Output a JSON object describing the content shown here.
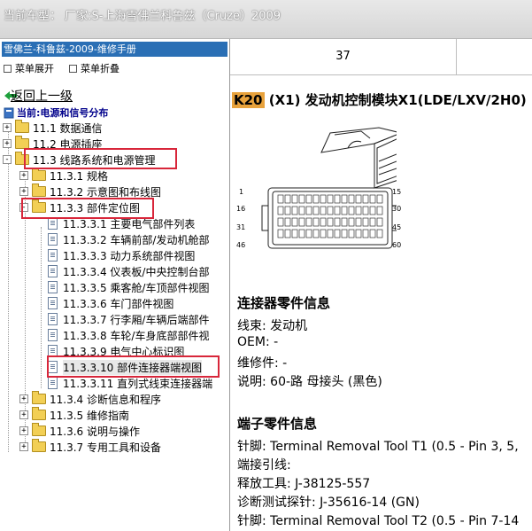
{
  "title": "当前车型：  厂家:S-上海雪佛兰科鲁兹（Cruze）2009",
  "left_panel": {
    "header": "雪佛兰-科鲁兹-2009-维修手册",
    "expand_all": "菜单展开",
    "collapse_all": "菜单折叠",
    "back_link": "返回上一级",
    "current": "当前:电源和信号分布",
    "tree": [
      {
        "label": "11.1 数据通信",
        "level": 0,
        "type": "folder",
        "toggle": "+"
      },
      {
        "label": "11.2 电源插座",
        "level": 0,
        "type": "folder",
        "toggle": "+"
      },
      {
        "label": "11.3 线路系统和电源管理",
        "level": 0,
        "type": "folder",
        "toggle": "-"
      },
      {
        "label": "11.3.1 规格",
        "level": 1,
        "type": "folder",
        "toggle": "+"
      },
      {
        "label": "11.3.2 示意图和布线图",
        "level": 1,
        "type": "folder",
        "toggle": "+"
      },
      {
        "label": "11.3.3 部件定位图",
        "level": 1,
        "type": "folder",
        "toggle": "-"
      },
      {
        "label": "11.3.3.1 主要电气部件列表",
        "level": 2,
        "type": "doc"
      },
      {
        "label": "11.3.3.2 车辆前部/发动机舱部",
        "level": 2,
        "type": "doc"
      },
      {
        "label": "11.3.3.3 动力系统部件视图",
        "level": 2,
        "type": "doc"
      },
      {
        "label": "11.3.3.4 仪表板/中央控制台部",
        "level": 2,
        "type": "doc"
      },
      {
        "label": "11.3.3.5 乘客舱/车顶部件视图",
        "level": 2,
        "type": "doc"
      },
      {
        "label": "11.3.3.6 车门部件视图",
        "level": 2,
        "type": "doc"
      },
      {
        "label": "11.3.3.7 行李厢/车辆后端部件",
        "level": 2,
        "type": "doc"
      },
      {
        "label": "11.3.3.8 车轮/车身底部部件视",
        "level": 2,
        "type": "doc"
      },
      {
        "label": "11.3.3.9 电气中心标识图",
        "level": 2,
        "type": "doc"
      },
      {
        "label": "11.3.3.10 部件连接器端视图",
        "level": 2,
        "type": "doc",
        "selected": true
      },
      {
        "label": "11.3.3.11 直列式线束连接器端",
        "level": 2,
        "type": "doc"
      },
      {
        "label": "11.3.4 诊断信息和程序",
        "level": 1,
        "type": "folder",
        "toggle": "+"
      },
      {
        "label": "11.3.5 维修指南",
        "level": 1,
        "type": "folder",
        "toggle": "+"
      },
      {
        "label": "11.3.6 说明与操作",
        "level": 1,
        "type": "folder",
        "toggle": "+"
      },
      {
        "label": "11.3.7 专用工具和设备",
        "level": 1,
        "type": "folder",
        "toggle": "+"
      }
    ]
  },
  "right_panel": {
    "table_cell": "37",
    "heading_code": "K20",
    "heading_text": "(X1) 发动机控制模块X1(LDE/LXV/2H0)",
    "pin_labels": [
      "1",
      "15",
      "16",
      "30",
      "31",
      "45",
      "46",
      "60"
    ],
    "connector_info_title": "连接器零件信息",
    "connector_lines": [
      "线束: 发动机",
      "OEM: -",
      "维修件: -",
      "说明: 60-路 母接头 (黑色)"
    ],
    "terminal_info_title": "端子零件信息",
    "terminal_lines": [
      "针脚: Terminal Removal Tool T1 (0.5 - Pin 3, 5,",
      "端接引线:",
      "释放工具: J-38125-557",
      "诊断测试探针: J-35616-14 (GN)",
      "针脚: Terminal Removal Tool T2 (0.5 - Pin 7-14"
    ]
  }
}
